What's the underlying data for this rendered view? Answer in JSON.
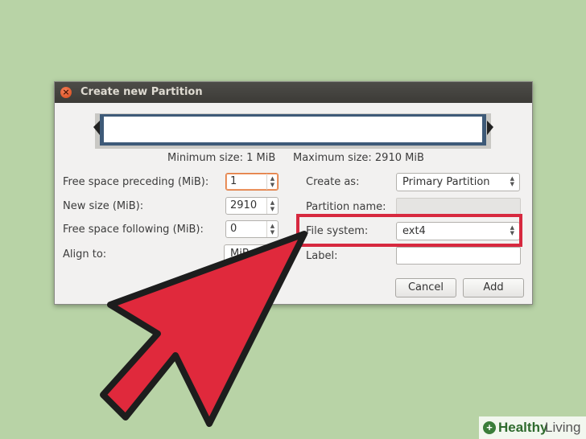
{
  "dialog": {
    "title": "Create new Partition",
    "close_icon": "close-icon"
  },
  "size_bar": {
    "min_label": "Minimum size: 1 MiB",
    "max_label": "Maximum size: 2910 MiB"
  },
  "left_fields": {
    "preceding_label": "Free space preceding (MiB):",
    "preceding_value": "1",
    "new_size_label": "New size (MiB):",
    "new_size_value": "2910",
    "following_label": "Free space following (MiB):",
    "following_value": "0",
    "align_label": "Align to:",
    "align_value": "MiB"
  },
  "right_fields": {
    "create_as_label": "Create as:",
    "create_as_value": "Primary Partition",
    "partition_name_label": "Partition name:",
    "file_system_label": "File system:",
    "file_system_value": "ext4",
    "label_label": "Label:"
  },
  "buttons": {
    "cancel": "Cancel",
    "add": "Add"
  },
  "watermark": {
    "brand_bold": "Healthy",
    "brand_rest": "Living",
    "icon": "plus-leaf-icon"
  },
  "colors": {
    "background": "#b8d3a6",
    "highlight": "#d7293f",
    "arrow": "#e0293c",
    "partition_border": "#3e5a78"
  }
}
